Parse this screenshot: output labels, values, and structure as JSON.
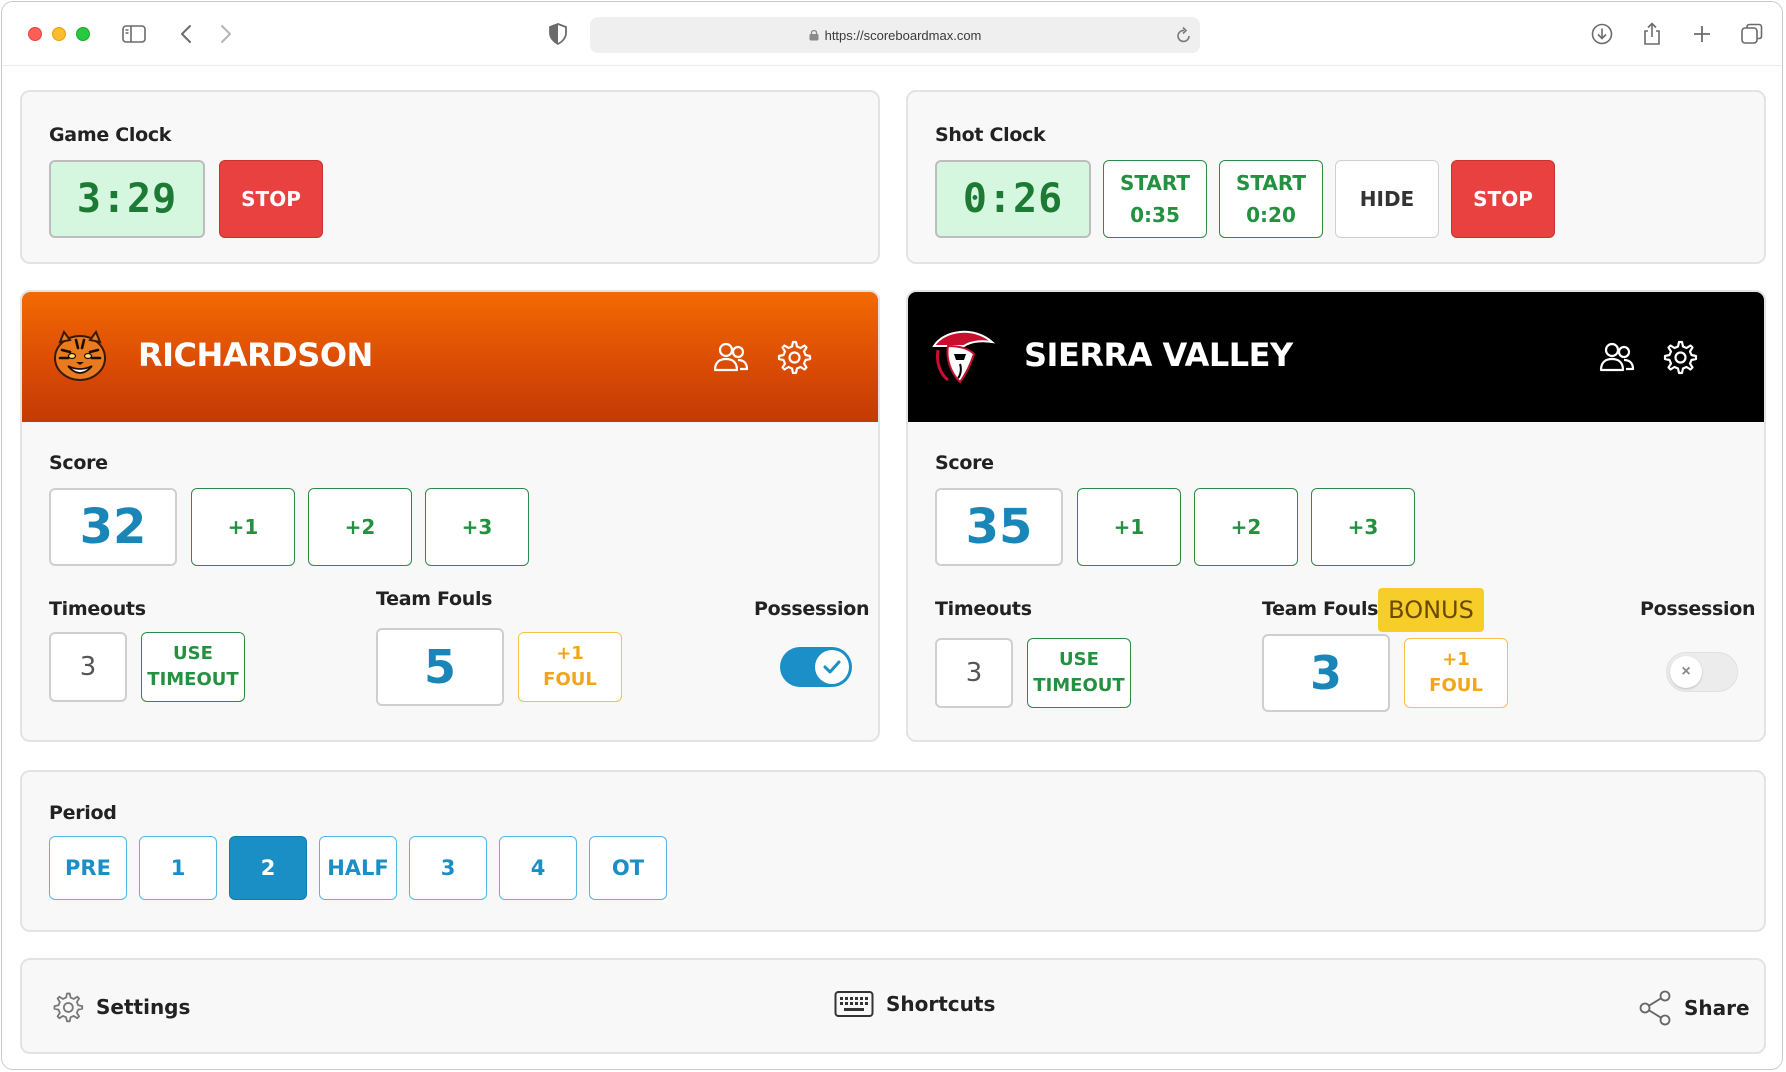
{
  "browser": {
    "url": "https://scoreboardmax.com"
  },
  "game_clock": {
    "label": "Game Clock",
    "time": "3:29",
    "stop_label": "STOP"
  },
  "shot_clock": {
    "label": "Shot Clock",
    "time": "0:26",
    "start_35_line1": "START",
    "start_35_line2": "0:35",
    "start_20_line1": "START",
    "start_20_line2": "0:20",
    "hide_label": "HIDE",
    "stop_label": "STOP"
  },
  "home": {
    "name": "RICHARDSON",
    "header_color": "#ee6100",
    "score_label": "Score",
    "score": "32",
    "plus1": "+1",
    "plus2": "+2",
    "plus3": "+3",
    "timeouts_label": "Timeouts",
    "timeouts": "3",
    "use_timeout_line1": "USE",
    "use_timeout_line2": "TIMEOUT",
    "fouls_label": "Team Fouls",
    "fouls": "5",
    "foul_btn_line1": "+1",
    "foul_btn_line2": "FOUL",
    "possession_label": "Possession",
    "possession": true
  },
  "away": {
    "name": "SIERRA VALLEY",
    "header_color": "#000000",
    "score_label": "Score",
    "score": "35",
    "plus1": "+1",
    "plus2": "+2",
    "plus3": "+3",
    "timeouts_label": "Timeouts",
    "timeouts": "3",
    "use_timeout_line1": "USE",
    "use_timeout_line2": "TIMEOUT",
    "fouls_label": "Team Fouls",
    "bonus_label": "BONUS",
    "fouls": "3",
    "foul_btn_line1": "+1",
    "foul_btn_line2": "FOUL",
    "possession_label": "Possession",
    "possession": false
  },
  "period": {
    "label": "Period",
    "options": [
      "PRE",
      "1",
      "2",
      "HALF",
      "3",
      "4",
      "OT"
    ],
    "selected": "2"
  },
  "footer": {
    "settings_label": "Settings",
    "shortcuts_label": "Shortcuts",
    "share_label": "Share"
  }
}
